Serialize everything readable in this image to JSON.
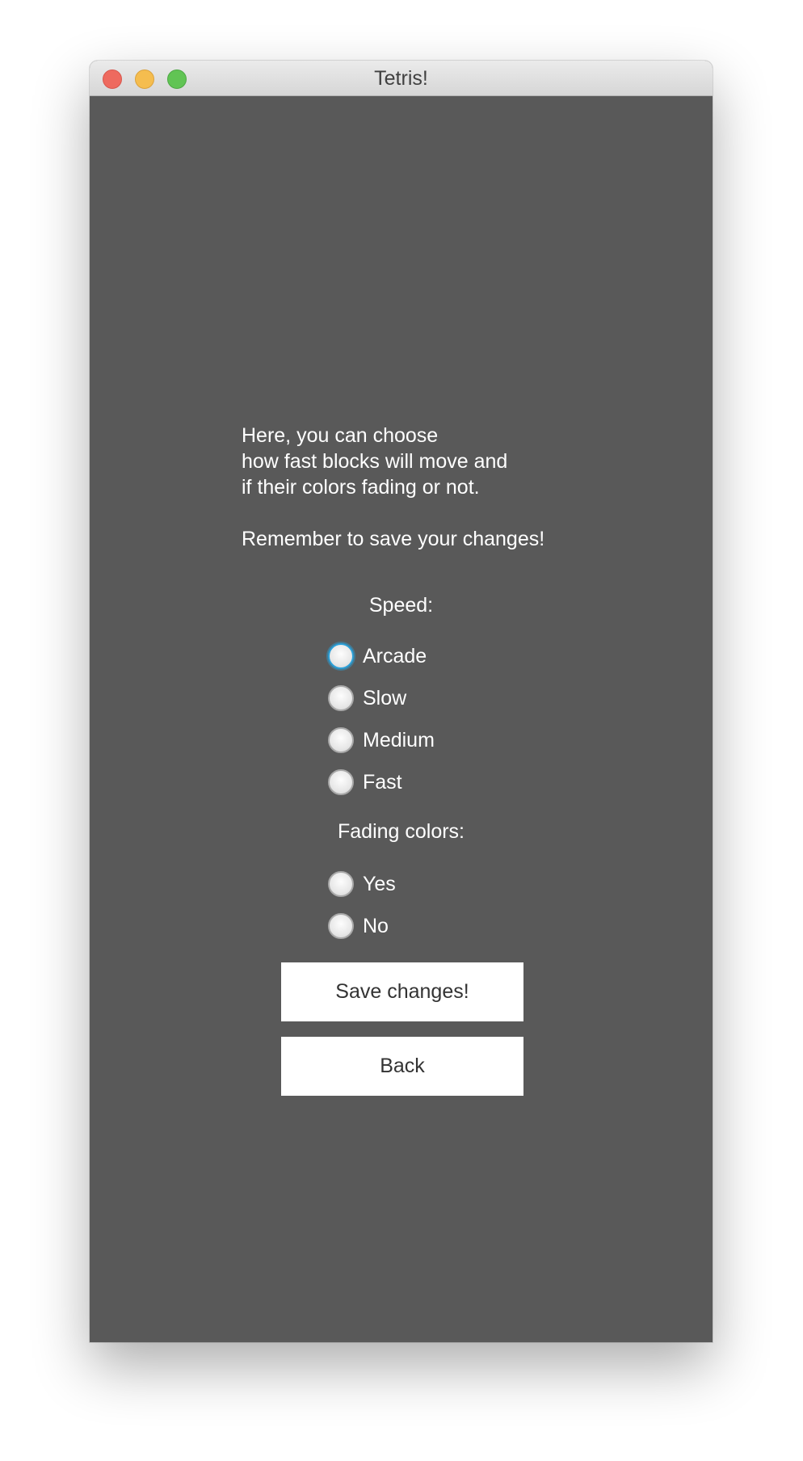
{
  "window": {
    "title": "Tetris!"
  },
  "info": {
    "lines": [
      "Here, you can choose",
      "how fast blocks will move and",
      "if their colors fading or not."
    ],
    "reminder": "Remember to save your changes!"
  },
  "speed": {
    "label": "Speed:",
    "options": [
      "Arcade",
      "Slow",
      "Medium",
      "Fast"
    ],
    "focused": "Arcade"
  },
  "fading": {
    "label": "Fading colors:",
    "options": [
      "Yes",
      "No"
    ]
  },
  "buttons": {
    "save": "Save changes!",
    "back": "Back"
  },
  "colors": {
    "background": "#595959",
    "text": "#ffffff",
    "focus_ring": "#2a9fd8",
    "button_bg": "#ffffff"
  },
  "icons": {
    "close": "close-icon",
    "minimize": "minimize-icon",
    "maximize": "maximize-icon"
  }
}
